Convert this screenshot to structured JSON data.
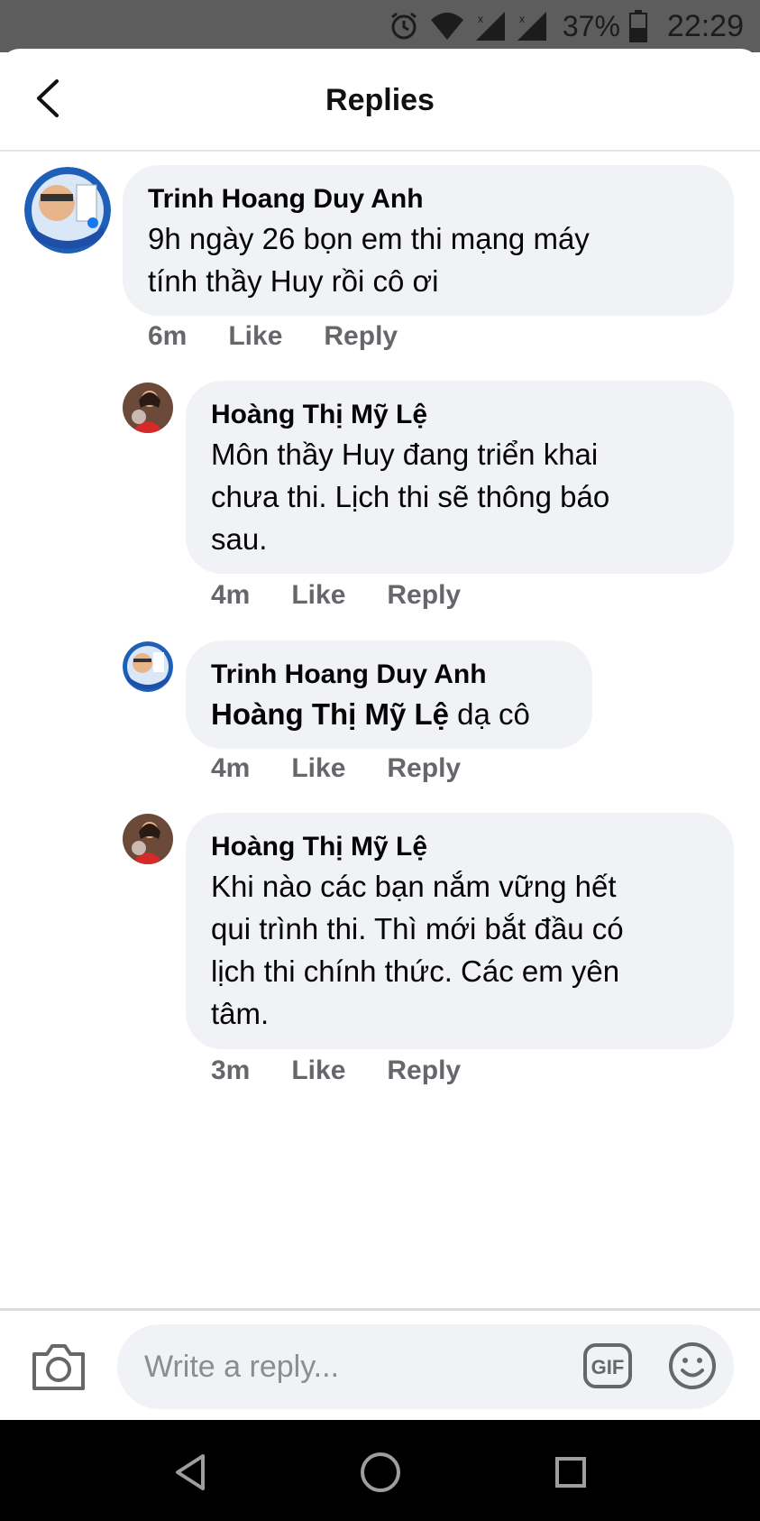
{
  "status_bar": {
    "battery_percent": "37%",
    "time": "22:29",
    "icons": [
      "alarm-icon",
      "wifi-icon",
      "signal-icon",
      "signal-icon",
      "battery-icon"
    ]
  },
  "header": {
    "title": "Replies",
    "back_icon": "chevron-left-icon"
  },
  "comments": [
    {
      "author": "Trinh Hoang Duy Anh",
      "lines": [
        "9h ngày 26 bọn em thi mạng máy",
        "tính thầy Huy rồi cô ơi"
      ],
      "time": "6m",
      "like_label": "Like",
      "reply_label": "Reply"
    },
    {
      "author": "Hoàng Thị Mỹ Lệ",
      "lines": [
        "Môn thầy Huy đang triển khai",
        "chưa thi. Lịch thi sẽ thông báo",
        "sau."
      ],
      "time": "4m",
      "like_label": "Like",
      "reply_label": "Reply"
    },
    {
      "author": "Trinh Hoang Duy Anh",
      "mention": "Hoàng Thị Mỹ Lệ",
      "text": " dạ cô",
      "time": "4m",
      "like_label": "Like",
      "reply_label": "Reply"
    },
    {
      "author": "Hoàng Thị Mỹ Lệ",
      "lines": [
        "Khi nào các bạn nắm vững hết",
        "qui trình thi. Thì mới bắt đầu có",
        "lịch thi chính thức. Các em yên",
        "tâm."
      ],
      "time": "3m",
      "like_label": "Like",
      "reply_label": "Reply"
    }
  ],
  "composer": {
    "placeholder": "Write a reply...",
    "gif_label": "GIF",
    "icons": [
      "camera-icon",
      "gif-icon",
      "emoji-icon"
    ]
  },
  "nav_bar": {
    "icons": [
      "back-triangle-icon",
      "home-circle-icon",
      "recents-square-icon"
    ]
  },
  "colors": {
    "bubble_bg": "#f0f2f5",
    "meta_text": "#65676b",
    "status_bar_bg": "#5d5d5d",
    "nav_bar_bg": "#000000"
  }
}
